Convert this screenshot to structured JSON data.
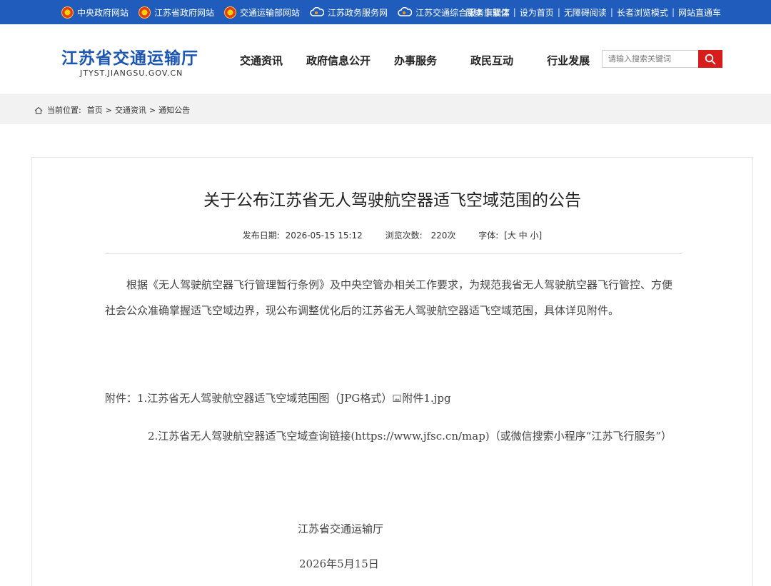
{
  "topbar": {
    "links": [
      {
        "label": "中央政府网站",
        "icon": "national-emblem-icon"
      },
      {
        "label": "江苏省政府网站",
        "icon": "national-emblem-icon"
      },
      {
        "label": "交通运输部网站",
        "icon": "national-emblem-icon"
      },
      {
        "label": "江苏政务服务网",
        "icon": "cloud-logo-icon"
      },
      {
        "label": "江苏交通综合服务旗舰店",
        "icon": "cloud-logo-icon"
      }
    ],
    "right": [
      "简体",
      "繁体",
      "设为首页",
      "无障碍阅读",
      "长者浏览模式",
      "网站直通车"
    ],
    "separator": "|"
  },
  "header": {
    "site_title": "江苏省交通运输厅",
    "site_domain": "JTYST.JIANGSU.GOV.CN",
    "nav": [
      "交通资讯",
      "政府信息公开",
      "办事服务",
      "政民互动",
      "行业发展"
    ],
    "search_placeholder": "请输入搜索关键词"
  },
  "breadcrumb": {
    "prefix": "当前位置:",
    "items": [
      "首页",
      "交通资讯",
      "通知公告"
    ],
    "separator": ">"
  },
  "article": {
    "title": "关于公布江苏省无人驾驶航空器适飞空域范围的公告",
    "date_label": "发布日期:",
    "date": "2026-05-15 15:12",
    "views_label": "浏览次数:",
    "views": "220次",
    "font_label": "字体:",
    "font_open": "[",
    "font_large": "大",
    "font_medium": "中",
    "font_small": "小",
    "font_close": "]",
    "paragraph": "根据《无人驾驶航空器飞行管理暂行条例》及中央空管办相关工作要求，为规范我省无人驾驶航空器飞行管控、方便社会公众准确掌握适飞空域边界，现公布调整优化后的江苏省无人驾驶航空器适飞空域范围，具体详见附件。",
    "attachment1_text": "附件：1.江苏省无人驾驶航空器适飞空域范围图（JPG格式）",
    "attachment1_file": "附件1.jpg",
    "attachment2_text": "2.江苏省无人驾驶航空器适飞空域查询链接(https://www.jfsc.cn/map)（或微信搜索小程序“江苏飞行服务”）",
    "signature": "江苏省交通运输厅",
    "sign_date": "2026年5月15日"
  },
  "colors": {
    "topbar_bg": "#1f5cbc",
    "brand_blue": "#1b56b3",
    "search_button": "#d71c1c",
    "breadcrumb_bg": "#f2f2f2"
  }
}
